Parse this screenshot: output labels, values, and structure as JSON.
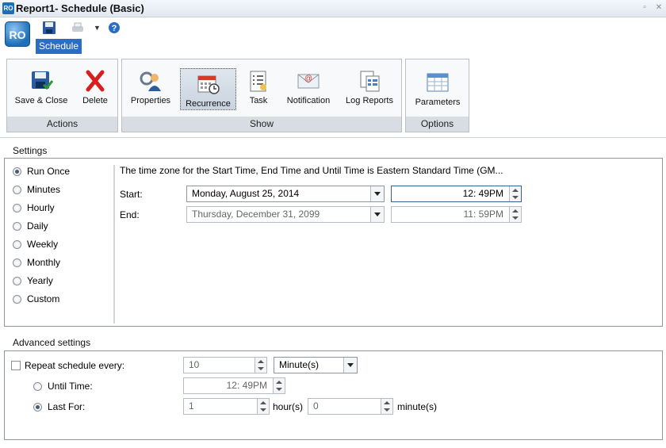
{
  "window": {
    "title": "Report1- Schedule (Basic)",
    "app_badge": "RO"
  },
  "quick_access": {
    "app_orb_label": "RO"
  },
  "tabs": [
    {
      "label": "Schedule"
    }
  ],
  "ribbon": {
    "groups": [
      {
        "caption": "Actions",
        "buttons": [
          {
            "label": "Save & Close",
            "icon": "save-close-icon"
          },
          {
            "label": "Delete",
            "icon": "delete-icon"
          }
        ]
      },
      {
        "caption": "Show",
        "buttons": [
          {
            "label": "Properties",
            "icon": "properties-icon"
          },
          {
            "label": "Recurrence",
            "icon": "recurrence-icon"
          },
          {
            "label": "Task",
            "icon": "task-icon"
          },
          {
            "label": "Notification",
            "icon": "notification-icon"
          },
          {
            "label": "Log Reports",
            "icon": "log-reports-icon"
          }
        ]
      },
      {
        "caption": "Options",
        "buttons": [
          {
            "label": "Parameters",
            "icon": "parameters-icon"
          }
        ]
      }
    ]
  },
  "settings": {
    "label": "Settings",
    "options": [
      "Run Once",
      "Minutes",
      "Hourly",
      "Daily",
      "Weekly",
      "Monthly",
      "Yearly",
      "Custom"
    ],
    "selected": "Run Once",
    "timezone_note": "The time zone for the Start Time, End Time and Until Time is Eastern Standard Time (GM...",
    "start": {
      "label": "Start:",
      "date": "Monday, August 25, 2014",
      "time": "12: 49PM"
    },
    "end": {
      "label": "End:",
      "date": "Thursday, December 31, 2099",
      "time": "11: 59PM"
    }
  },
  "advanced": {
    "label": "Advanced settings",
    "repeat_label": "Repeat schedule every:",
    "repeat_value": "10",
    "repeat_unit": "Minute(s)",
    "until_label": "Until Time:",
    "until_value": "12: 49PM",
    "last_for_label": "Last For:",
    "hours_value": "1",
    "hours_unit": "hour(s)",
    "minutes_value": "0",
    "minutes_unit": "minute(s)"
  },
  "colors": {
    "tab_active": "#2b6cc4",
    "panel_border": "#8d96a0"
  }
}
